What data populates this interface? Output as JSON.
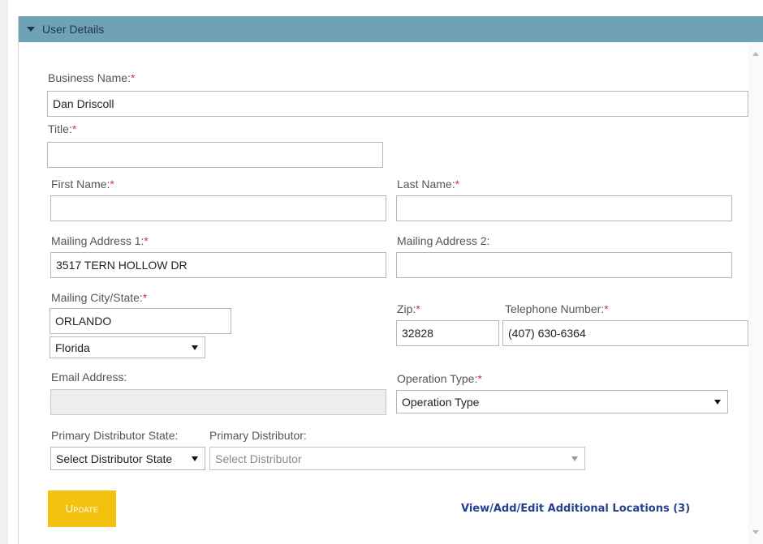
{
  "panel": {
    "title": "User Details"
  },
  "form": {
    "business_name": {
      "label": "Business Name:",
      "required_mark": "*",
      "value": "Dan Driscoll"
    },
    "title": {
      "label": "Title:",
      "required_mark": "*",
      "value": ""
    },
    "first_name": {
      "label": "First Name:",
      "required_mark": "*",
      "value": ""
    },
    "last_name": {
      "label": "Last Name:",
      "required_mark": "*",
      "value": ""
    },
    "mailing_address_1": {
      "label": "Mailing Address 1:",
      "required_mark": "*",
      "value": "3517 TERN HOLLOW DR"
    },
    "mailing_address_2": {
      "label": "Mailing Address 2:",
      "value": ""
    },
    "mailing_city_state": {
      "label": "Mailing City/State:",
      "required_mark": "*",
      "city_value": "ORLANDO",
      "state_selected": "Florida"
    },
    "zip": {
      "label": "Zip:",
      "required_mark": "*",
      "value": "32828"
    },
    "telephone": {
      "label": "Telephone Number:",
      "required_mark": "*",
      "value": "(407) 630-6364"
    },
    "email": {
      "label": "Email Address:",
      "value": ""
    },
    "operation_type": {
      "label": "Operation Type:",
      "required_mark": "*",
      "selected": "Operation Type"
    },
    "primary_distributor_state": {
      "label": "Primary Distributor State:",
      "selected": "Select Distributor State"
    },
    "primary_distributor": {
      "label": "Primary Distributor:",
      "selected": "Select Distributor"
    }
  },
  "actions": {
    "update_label": "Update",
    "locations_link": "View/Add/Edit Additional Locations (3)"
  }
}
